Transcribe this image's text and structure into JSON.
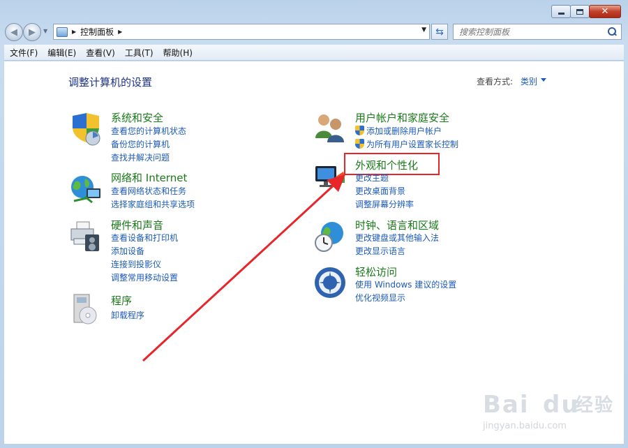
{
  "window": {
    "caption_buttons": [
      "minimize-icon",
      "maximize-icon",
      "close-icon"
    ]
  },
  "nav": {
    "address_segments": [
      "控制面板"
    ],
    "search_placeholder": "搜索控制面板"
  },
  "menu": [
    "文件(F)",
    "编辑(E)",
    "查看(V)",
    "工具(T)",
    "帮助(H)"
  ],
  "page": {
    "title": "调整计算机的设置",
    "view_by_label": "查看方式:",
    "view_by_value": "类别"
  },
  "categories": [
    {
      "icon": "shield-security-icon",
      "title": "系统和安全",
      "links": [
        "查看您的计算机状态",
        "备份您的计算机",
        "查找并解决问题"
      ]
    },
    {
      "icon": "globe-network-icon",
      "title": "网络和 Internet",
      "links": [
        "查看网络状态和任务",
        "选择家庭组和共享选项"
      ]
    },
    {
      "icon": "printer-hardware-icon",
      "title": "硬件和声音",
      "links": [
        "查看设备和打印机",
        "添加设备",
        "连接到投影仪",
        "调整常用移动设置"
      ]
    },
    {
      "icon": "programs-icon",
      "title": "程序",
      "links": [
        "卸载程序"
      ]
    },
    {
      "icon": "users-icon",
      "title": "用户帐户和家庭安全",
      "links": [
        "添加或删除用户帐户",
        "为所有用户设置家长控制"
      ]
    },
    {
      "icon": "monitor-personalization-icon",
      "title": "外观和个性化",
      "links": [
        "更改主题",
        "更改桌面背景",
        "调整屏幕分辨率"
      ]
    },
    {
      "icon": "clock-globe-icon",
      "title": "时钟、语言和区域",
      "links": [
        "更改键盘或其他输入法",
        "更改显示语言"
      ]
    },
    {
      "icon": "ease-of-access-icon",
      "title": "轻松访问",
      "links": [
        "使用 Windows 建议的设置",
        "优化视频显示"
      ]
    }
  ],
  "annotation": {
    "highlight_color": "#e8262a",
    "arrow_color": "#e8262a"
  },
  "watermark": {
    "brand": "Bai",
    "brand2": "du",
    "suffix": "经验",
    "url": "jingyan.baidu.com"
  },
  "colors": {
    "category_title": "#1a7a1a",
    "link": "#1c5ab8",
    "page_title": "#1e3287"
  }
}
